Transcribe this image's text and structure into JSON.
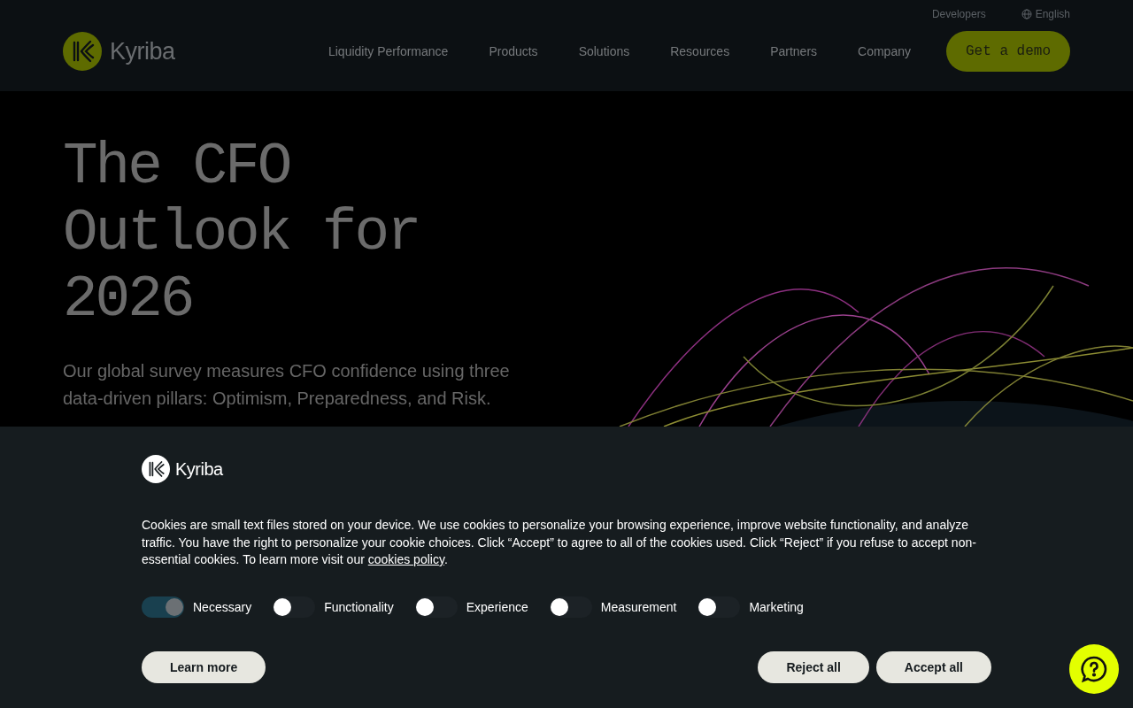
{
  "utility_links": [
    {
      "kind": "link",
      "label": "Developers"
    },
    {
      "kind": "language",
      "label": "English"
    }
  ],
  "brand": {
    "name": "Kyriba"
  },
  "nav": [
    "Liquidity Performance",
    "Products",
    "Solutions",
    "Resources",
    "Partners",
    "Company"
  ],
  "cta": "Get a demo",
  "hero": {
    "title": "The CFO Outlook for 2026",
    "subtitle": "Our global survey measures CFO confidence using three data-driven pillars: Optimism, Preparedness, and Risk."
  },
  "cookie_banner": {
    "brand": "Kyriba",
    "text": "Cookies are small text files stored on your device. We use cookies to personalize your browsing experience, improve website functionality, and analyze traffic. You have the right to personalize your cookie choices. Click “Accept” to agree to all of the cookies used. Click “Reject” if you refuse to accept non-essential cookies. To learn more visit our",
    "link": "cookies policy",
    "after": ".",
    "toggles": [
      {
        "label": "Necessary",
        "on": true
      },
      {
        "label": "Functionality",
        "on": false
      },
      {
        "label": "Experience",
        "on": false
      },
      {
        "label": "Measurement",
        "on": false
      },
      {
        "label": "Marketing",
        "on": false
      }
    ],
    "learn_more": "Learn more",
    "buttons": [
      "Reject all",
      "Accept all"
    ]
  }
}
